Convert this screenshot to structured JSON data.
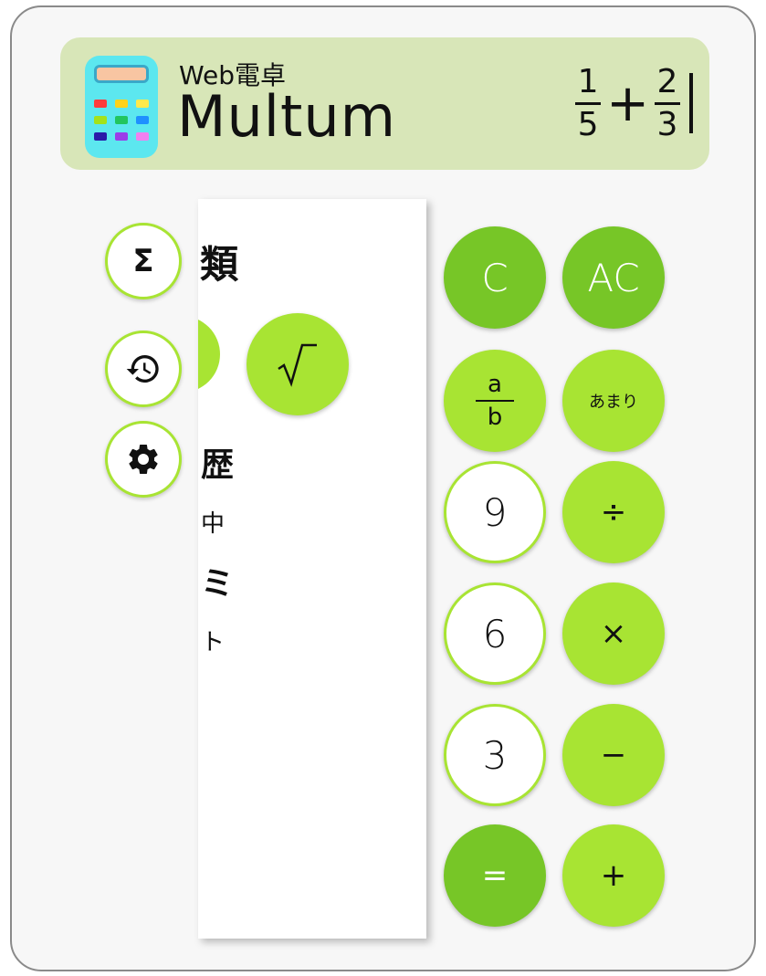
{
  "app": {
    "subtitle": "Web電卓",
    "title": "Multum"
  },
  "display": {
    "frac1": {
      "num": "1",
      "den": "5"
    },
    "operator": "+",
    "frac2": {
      "num": "2",
      "den": "3"
    }
  },
  "side_buttons": {
    "sigma": "Σ",
    "history_icon": "history-icon",
    "settings_icon": "gear-icon"
  },
  "panel": {
    "heading": "類",
    "sqrt_label": "√",
    "line1": "歴",
    "line2": "中",
    "line3": "ミ",
    "line4": "ト"
  },
  "keypad": {
    "clear": "C",
    "all_clear": "AC",
    "fraction": {
      "top": "a",
      "bottom": "b"
    },
    "remainder": "あまり",
    "nine": "9",
    "divide": "÷",
    "six": "6",
    "multiply": "×",
    "three": "3",
    "minus": "−",
    "equals": "=",
    "plus": "+"
  },
  "colors": {
    "accent_dark": "#77c627",
    "accent_light": "#a8e433",
    "header_bg": "#d8e6b8",
    "logo_bg": "#5ce7ef"
  }
}
